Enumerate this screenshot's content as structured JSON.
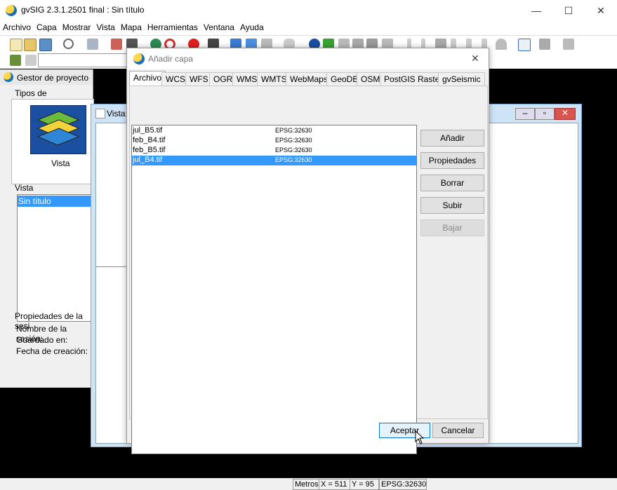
{
  "window": {
    "title": "gvSIG 2.3.1.2501 final : Sin título",
    "minimize": "—",
    "maximize": "☐",
    "close": "✕"
  },
  "menubar": [
    "Archivo",
    "Capa",
    "Mostrar",
    "Vista",
    "Mapa",
    "Herramientas",
    "Ventana",
    "Ayuda"
  ],
  "project_manager": {
    "title": "Gestor de proyecto",
    "doc_types_label": "Tipos de documentos",
    "doc_type": "Vista",
    "view_section_label": "Vista",
    "views": [
      "Sin título"
    ],
    "session_props_label": "Propiedades de la sesi",
    "session_name_label": "Nombre de la sesión:",
    "saved_in_label": "Guardado en:",
    "created_label": "Fecha de creación:"
  },
  "view_window": {
    "title": "Vista:"
  },
  "dialog": {
    "title": "Añadir capa",
    "close": "✕",
    "tabs": [
      "Archivo",
      "WCS",
      "WFS",
      "OGR",
      "WMS",
      "WMTS",
      "WebMaps",
      "GeoDB",
      "OSM",
      "PostGIS Raster",
      "gvSeismic"
    ],
    "active_tab": "Archivo",
    "files": [
      {
        "name": "jul_B5.tif",
        "crs": "EPSG:32630",
        "selected": false
      },
      {
        "name": "feb_B4.tif",
        "crs": "EPSG:32630",
        "selected": false
      },
      {
        "name": "feb_B5.tif",
        "crs": "EPSG:32630",
        "selected": false
      },
      {
        "name": "jul_B4.tif",
        "crs": "EPSG:32630",
        "selected": true
      }
    ],
    "buttons": {
      "add": "Añadir",
      "properties": "Propiedades",
      "delete": "Borrar",
      "up": "Subir",
      "down": "Bajar"
    },
    "accept": "Aceptar",
    "cancel": "Cancelar"
  },
  "status": {
    "units": "Metros",
    "x": "X = 511",
    "y": "Y = 95",
    "crs": "EPSG:32630"
  },
  "colors": {
    "selection": "#3399ff",
    "desktop": "#000000",
    "window_frame": "#cfe3f7"
  }
}
